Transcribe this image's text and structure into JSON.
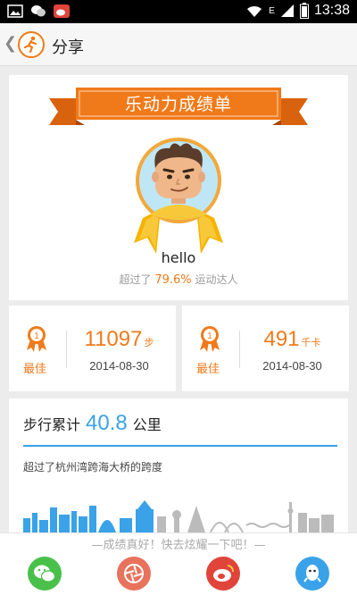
{
  "status_bar": {
    "time": "13:38",
    "network": "E"
  },
  "header": {
    "back_icon": "chevron-left-icon",
    "title": "分享"
  },
  "report": {
    "ribbon_title": "乐动力成绩单",
    "username": "hello",
    "rank_prefix": "超过了",
    "rank_percent": "79.6%",
    "rank_suffix": "运动达人"
  },
  "best_records": [
    {
      "label": "最佳",
      "value": "11097",
      "unit": "步",
      "date": "2014-08-30"
    },
    {
      "label": "最佳",
      "value": "491",
      "unit": "千卡",
      "date": "2014-08-30"
    }
  ],
  "walk": {
    "label": "步行累计",
    "distance": "40.8",
    "unit": "公里",
    "comparison": "超过了杭州湾跨海大桥的跨度"
  },
  "share_sheet": {
    "message": "—成绩真好！快去炫耀一下吧！—",
    "buttons": [
      {
        "name": "wechat",
        "icon": "wechat-icon"
      },
      {
        "name": "moments",
        "icon": "camera-aperture-icon"
      },
      {
        "name": "weibo",
        "icon": "weibo-icon"
      },
      {
        "name": "qq",
        "icon": "qq-icon"
      }
    ]
  },
  "colors": {
    "accent": "#f07a1a",
    "blue": "#3aa2e8",
    "background": "#ececec"
  }
}
